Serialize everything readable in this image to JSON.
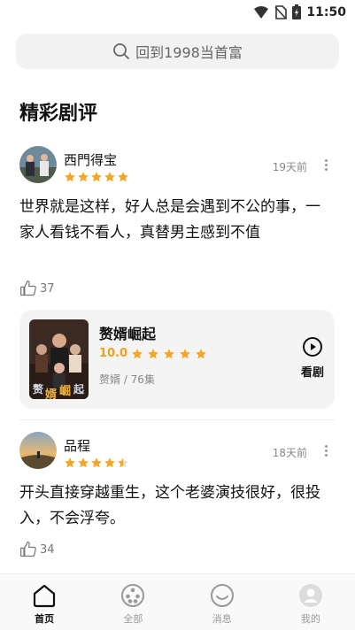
{
  "status": {
    "time": "11:50"
  },
  "search": {
    "text": "回到1998当首富"
  },
  "section_title": "精彩剧评",
  "colors": {
    "star": "#f5a623",
    "rating": "#f0a020"
  },
  "reviews": [
    {
      "user": "西門得宝",
      "rating": 5,
      "time": "19天前",
      "content": "世界就是这样，好人总是会遇到不公的事，一家人看钱不看人，真替男主感到不值",
      "likes": "37",
      "drama": {
        "title": "赘婿崛起",
        "score": "10.0",
        "meta": "赘婿 / 76集",
        "watch_label": "看剧",
        "poster_text": [
          "赘",
          "婿",
          "崛",
          "起"
        ]
      }
    },
    {
      "user": "品程",
      "rating": 4.5,
      "time": "18天前",
      "content": "开头直接穿越重生，这个老婆演技很好，很投入，不会浮夸。",
      "likes": "34"
    }
  ],
  "tabs": [
    {
      "label": "首页",
      "icon": "home-icon",
      "active": true
    },
    {
      "label": "全部",
      "icon": "film-reel-icon",
      "active": false
    },
    {
      "label": "消息",
      "icon": "message-icon",
      "active": false
    },
    {
      "label": "我的",
      "icon": "profile-icon",
      "active": false
    }
  ]
}
